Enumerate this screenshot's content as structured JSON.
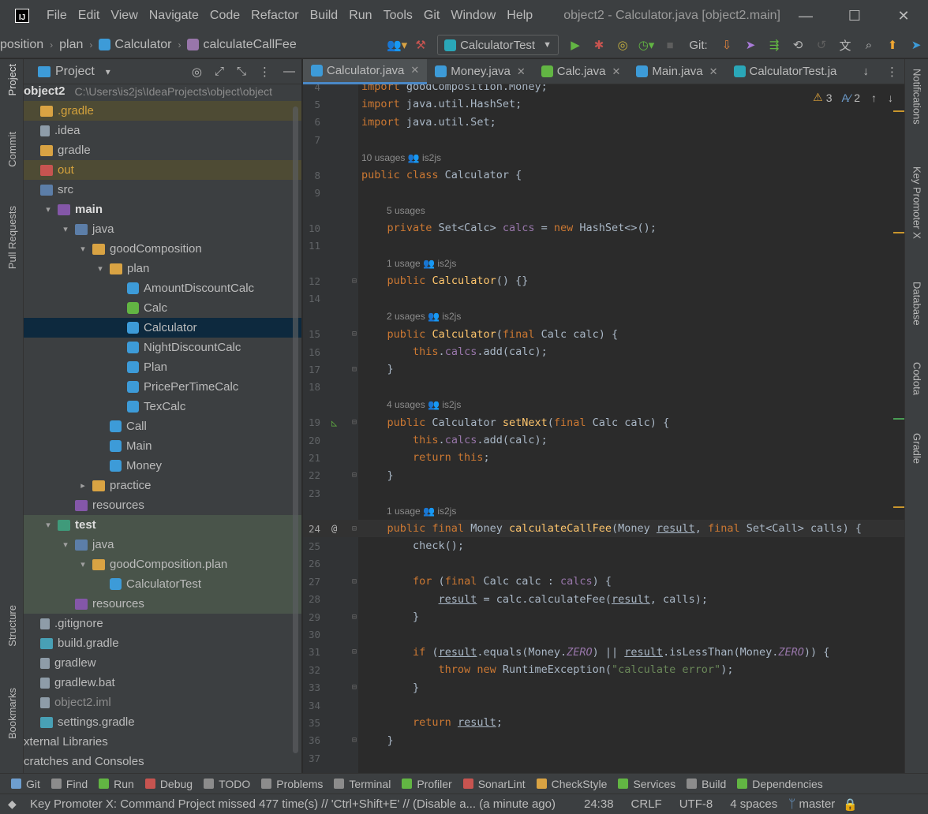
{
  "window": {
    "title": "object2 - Calculator.java [object2.main]",
    "menu": [
      "File",
      "Edit",
      "View",
      "Navigate",
      "Code",
      "Refactor",
      "Build",
      "Run",
      "Tools",
      "Git",
      "Window",
      "Help"
    ],
    "minimize": "—",
    "maximize": "☐",
    "close": "✕"
  },
  "navbar": {
    "crumbs": [
      "position",
      "plan",
      "Calculator",
      "calculateCallFee"
    ],
    "run_config": "CalculatorTest",
    "git_label": "Git:"
  },
  "left_stripe": {
    "tabs": [
      "Project",
      "Commit",
      "Pull Requests",
      "Structure",
      "Bookmarks"
    ]
  },
  "project_panel": {
    "title": "Project",
    "root_name": "object2",
    "root_path": "C:\\Users\\is2js\\IdeaProjects\\object\\object",
    "tree": [
      {
        "label": ".gradle",
        "depth": 0,
        "icon": "folder",
        "style": "ignored"
      },
      {
        "label": ".idea",
        "depth": 0,
        "icon": "file"
      },
      {
        "label": "gradle",
        "depth": 0,
        "icon": "folder"
      },
      {
        "label": "out",
        "depth": 0,
        "icon": "out",
        "style": "ignored"
      },
      {
        "label": "src",
        "depth": 0,
        "icon": "src"
      },
      {
        "label": "main",
        "depth": 1,
        "icon": "res",
        "arrow": "▾",
        "bold": true
      },
      {
        "label": "java",
        "depth": 2,
        "icon": "src",
        "arrow": "▾"
      },
      {
        "label": "goodComposition",
        "depth": 3,
        "icon": "folder",
        "arrow": "▾"
      },
      {
        "label": "plan",
        "depth": 4,
        "icon": "folder",
        "arrow": "▾"
      },
      {
        "label": "AmountDiscountCalc",
        "depth": 5,
        "icon": "java"
      },
      {
        "label": "Calc",
        "depth": 5,
        "icon": "calc"
      },
      {
        "label": "Calculator",
        "depth": 5,
        "icon": "java",
        "style": "selected"
      },
      {
        "label": "NightDiscountCalc",
        "depth": 5,
        "icon": "java"
      },
      {
        "label": "Plan",
        "depth": 5,
        "icon": "java"
      },
      {
        "label": "PricePerTimeCalc",
        "depth": 5,
        "icon": "java"
      },
      {
        "label": "TexCalc",
        "depth": 5,
        "icon": "java"
      },
      {
        "label": "Call",
        "depth": 4,
        "icon": "java"
      },
      {
        "label": "Main",
        "depth": 4,
        "icon": "java"
      },
      {
        "label": "Money",
        "depth": 4,
        "icon": "java"
      },
      {
        "label": "practice",
        "depth": 3,
        "icon": "folder",
        "arrow": "▸"
      },
      {
        "label": "resources",
        "depth": 2,
        "icon": "res"
      },
      {
        "label": "test",
        "depth": 1,
        "icon": "test",
        "arrow": "▾",
        "bold": true,
        "style": "test-bg"
      },
      {
        "label": "java",
        "depth": 2,
        "icon": "src",
        "arrow": "▾",
        "style": "test-bg"
      },
      {
        "label": "goodComposition.plan",
        "depth": 3,
        "icon": "folder",
        "arrow": "▾",
        "style": "test-bg"
      },
      {
        "label": "CalculatorTest",
        "depth": 4,
        "icon": "java",
        "style": "test-bg"
      },
      {
        "label": "resources",
        "depth": 2,
        "icon": "res",
        "style": "test-bg"
      },
      {
        "label": ".gitignore",
        "depth": 0,
        "icon": "file"
      },
      {
        "label": "build.gradle",
        "depth": 0,
        "icon": "gradle"
      },
      {
        "label": "gradlew",
        "depth": 0,
        "icon": "file"
      },
      {
        "label": "gradlew.bat",
        "depth": 0,
        "icon": "file"
      },
      {
        "label": "object2.iml",
        "depth": 0,
        "icon": "file",
        "style": "muted"
      },
      {
        "label": "settings.gradle",
        "depth": 0,
        "icon": "gradle"
      },
      {
        "label": "xternal Libraries",
        "depth": -1,
        "icon": "none"
      },
      {
        "label": "cratches and Consoles",
        "depth": -1,
        "icon": "none"
      }
    ]
  },
  "editor": {
    "tabs": [
      {
        "label": "Calculator.java",
        "active": true,
        "color": "#3d9bd8"
      },
      {
        "label": "Money.java",
        "active": false,
        "color": "#3d9bd8"
      },
      {
        "label": "Calc.java",
        "active": false,
        "color": "#62b543"
      },
      {
        "label": "Main.java",
        "active": false,
        "color": "#3d9bd8"
      },
      {
        "label": "CalculatorTest.ja",
        "active": false,
        "color": "#2aa7b8"
      }
    ],
    "warnings": "3",
    "weak_warnings": "2",
    "current_line": 24,
    "lines": [
      {
        "n": "4",
        "html": "<span class='kw'>import</span> goodComposition.Money;"
      },
      {
        "n": "5",
        "html": "<span class='kw'>import</span> java.util.HashSet;"
      },
      {
        "n": "6",
        "html": "<span class='kw'>import</span> java.util.Set;"
      },
      {
        "n": "7",
        "html": ""
      },
      {
        "hint": "10 usages   👥 is2js"
      },
      {
        "n": "8",
        "html": "<span class='kw'>public class</span> Calculator {"
      },
      {
        "n": "9",
        "html": ""
      },
      {
        "hint": "5 usages",
        "indent": 1
      },
      {
        "n": "10",
        "html": "    <span class='kw'>private</span> Set&lt;Calc&gt; <span class='fld'>calcs</span> = <span class='kw'>new</span> HashSet&lt;&gt;();"
      },
      {
        "n": "11",
        "html": ""
      },
      {
        "hint": "1 usage   👥 is2js",
        "indent": 1
      },
      {
        "n": "12",
        "html": "    <span class='kw'>public</span> <span class='fn'>Calculator</span>() {}"
      },
      {
        "n": "14",
        "html": ""
      },
      {
        "hint": "2 usages   👥 is2js",
        "indent": 1
      },
      {
        "n": "15",
        "html": "    <span class='kw'>public</span> <span class='fn'>Calculator</span>(<span class='kw'>final</span> Calc calc) {"
      },
      {
        "n": "16",
        "html": "        <span class='kw'>this</span>.<span class='fld'>calcs</span>.add(calc);"
      },
      {
        "n": "17",
        "html": "    }"
      },
      {
        "n": "18",
        "html": ""
      },
      {
        "hint": "4 usages   👥 is2js",
        "indent": 1
      },
      {
        "n": "19",
        "html": "    <span class='kw'>public</span> Calculator <span class='fn'>setNext</span>(<span class='kw'>final</span> Calc calc) {"
      },
      {
        "n": "20",
        "html": "        <span class='kw'>this</span>.<span class='fld'>calcs</span>.add(calc);"
      },
      {
        "n": "21",
        "html": "        <span class='kw'>return this</span>;"
      },
      {
        "n": "22",
        "html": "    }"
      },
      {
        "n": "23",
        "html": ""
      },
      {
        "hint": "1 usage   👥 is2js",
        "indent": 1
      },
      {
        "n": "24",
        "html": "    <span class='kw'>public final</span> Money <span class='fn'>calculateCallFee</span>(Money <span class='ul'>result</span>, <span class='kw'>final</span> Set&lt;Call&gt; calls) {"
      },
      {
        "n": "25",
        "html": "        check();"
      },
      {
        "n": "26",
        "html": ""
      },
      {
        "n": "27",
        "html": "        <span class='kw'>for</span> (<span class='kw'>final</span> Calc calc : <span class='fld'>calcs</span>) {"
      },
      {
        "n": "28",
        "html": "            <span class='ul'>result</span> = calc.calculateFee(<span class='ul'>result</span>, calls);"
      },
      {
        "n": "29",
        "html": "        }"
      },
      {
        "n": "30",
        "html": ""
      },
      {
        "n": "31",
        "html": "        <span class='kw'>if</span> (<span class='ul'>result</span>.equals(Money.<span class='fld ital'>ZERO</span>) || <span class='ul'>result</span>.isLessThan(Money.<span class='fld ital'>ZERO</span>)) {"
      },
      {
        "n": "32",
        "html": "            <span class='kw'>throw new</span> RuntimeException(<span class='str'>\"calculate error\"</span>);"
      },
      {
        "n": "33",
        "html": "        }"
      },
      {
        "n": "34",
        "html": ""
      },
      {
        "n": "35",
        "html": "        <span class='kw'>return</span> <span class='ul'>result</span>;"
      },
      {
        "n": "36",
        "html": "    }"
      },
      {
        "n": "37",
        "html": ""
      }
    ]
  },
  "right_stripe": {
    "tabs": [
      "Notifications",
      "Key Promoter X",
      "Database",
      "Codota",
      "Gradle"
    ]
  },
  "bottom_bar": {
    "items": [
      {
        "label": "Git",
        "color": "#6e9ecf"
      },
      {
        "label": "Find",
        "color": "#8c8c8c"
      },
      {
        "label": "Run",
        "color": "#62b543"
      },
      {
        "label": "Debug",
        "color": "#c75450"
      },
      {
        "label": "TODO",
        "color": "#8c8c8c"
      },
      {
        "label": "Problems",
        "color": "#8c8c8c"
      },
      {
        "label": "Terminal",
        "color": "#8c8c8c"
      },
      {
        "label": "Profiler",
        "color": "#62b543"
      },
      {
        "label": "SonarLint",
        "color": "#c75450"
      },
      {
        "label": "CheckStyle",
        "color": "#d9a343"
      },
      {
        "label": "Services",
        "color": "#62b543"
      },
      {
        "label": "Build",
        "color": "#8c8c8c"
      },
      {
        "label": "Dependencies",
        "color": "#62b543"
      }
    ]
  },
  "status_bar": {
    "message": "Key Promoter X: Command Project missed 477 time(s) // 'Ctrl+Shift+E' // (Disable a... (a minute ago)",
    "position": "24:38",
    "line_sep": "CRLF",
    "encoding": "UTF-8",
    "indent": "4 spaces",
    "branch": "master"
  }
}
